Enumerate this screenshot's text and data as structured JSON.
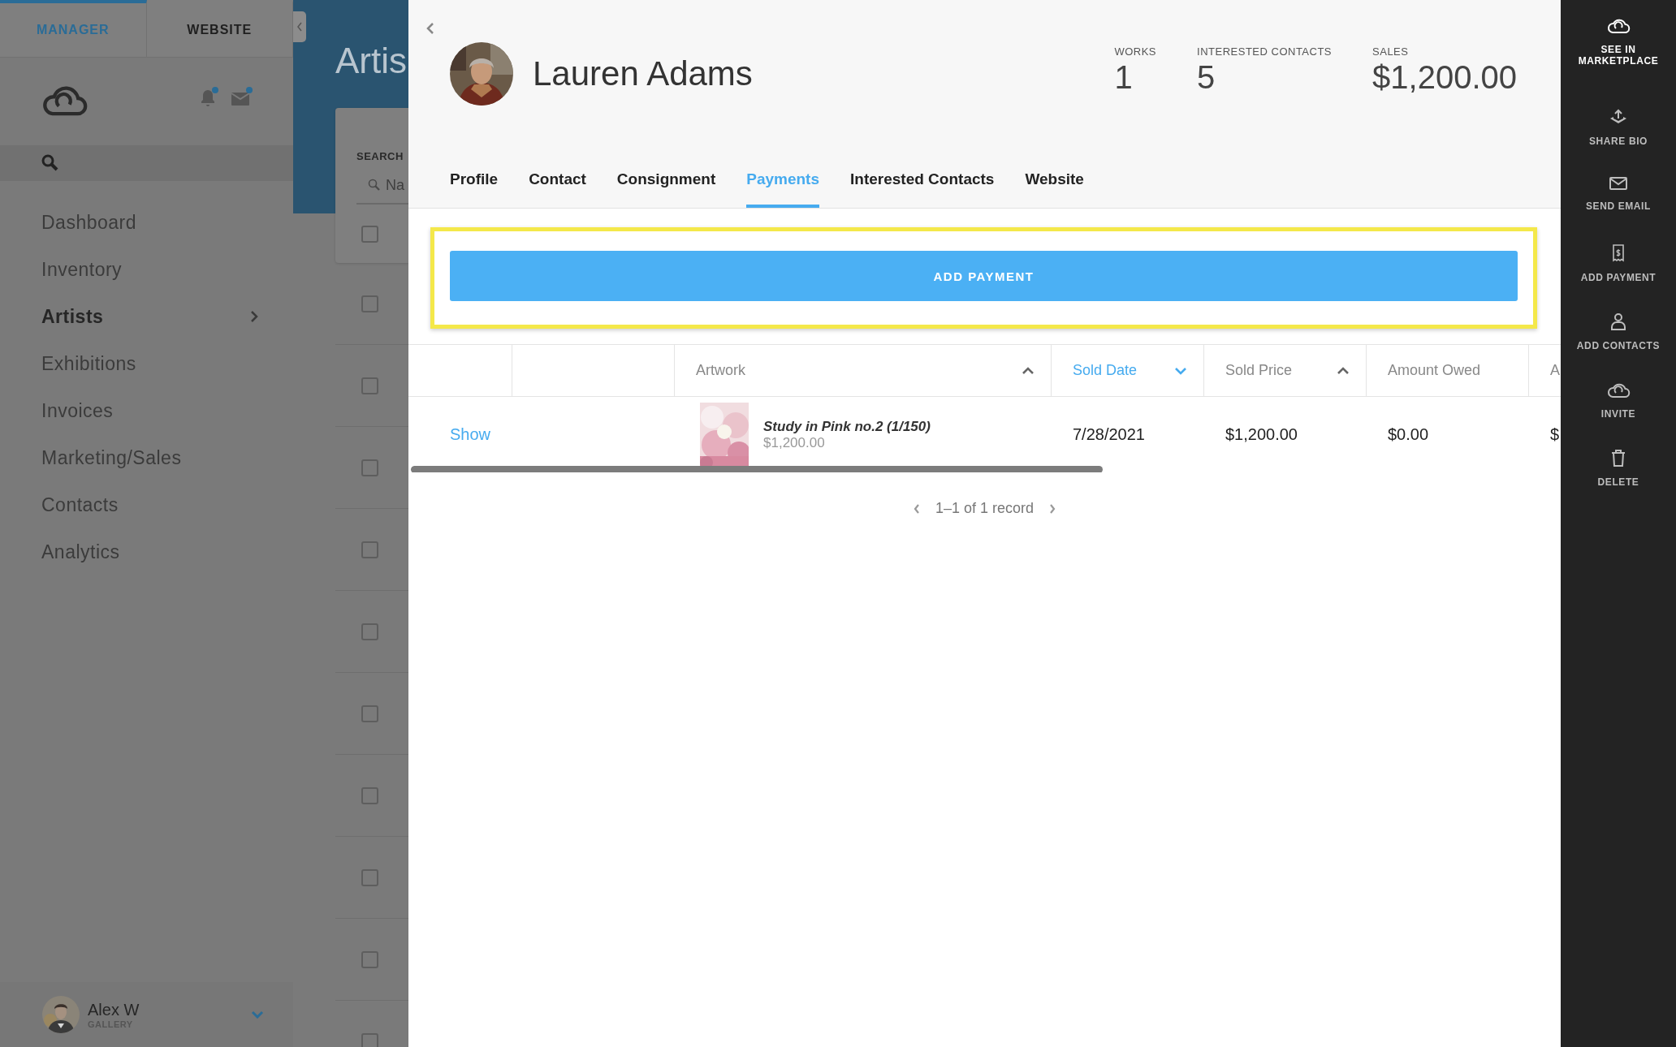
{
  "sidebar": {
    "tabs": [
      {
        "label": "MANAGER",
        "selected": true
      },
      {
        "label": "WEBSITE",
        "selected": false
      }
    ],
    "bell_unread": true,
    "mail_unread": true,
    "nav": [
      {
        "label": "Dashboard",
        "selected": false,
        "has_submenu": false
      },
      {
        "label": "Inventory",
        "selected": false,
        "has_submenu": false
      },
      {
        "label": "Artists",
        "selected": true,
        "has_submenu": true
      },
      {
        "label": "Exhibitions",
        "selected": false,
        "has_submenu": false
      },
      {
        "label": "Invoices",
        "selected": false,
        "has_submenu": false
      },
      {
        "label": "Marketing/Sales",
        "selected": false,
        "has_submenu": false
      },
      {
        "label": "Contacts",
        "selected": false,
        "has_submenu": false
      },
      {
        "label": "Analytics",
        "selected": false,
        "has_submenu": false
      }
    ],
    "user": {
      "name": "Alex W",
      "role": "GALLERY"
    }
  },
  "background_page": {
    "title": "Artis",
    "search_label": "SEARCH",
    "search_placeholder": "Na",
    "rows": [
      {
        "checked": false
      },
      {
        "checked": false
      },
      {
        "checked": false
      },
      {
        "checked": false
      },
      {
        "checked": false
      },
      {
        "checked": false
      },
      {
        "checked": false
      },
      {
        "checked": false
      },
      {
        "checked": false
      },
      {
        "checked": false
      },
      {
        "checked": false
      }
    ]
  },
  "drawer": {
    "artist_name": "Lauren Adams",
    "stats": [
      {
        "label": "WORKS",
        "value": "1"
      },
      {
        "label": "INTERESTED CONTACTS",
        "value": "5"
      },
      {
        "label": "SALES",
        "value": "$1,200.00"
      }
    ],
    "tabs": [
      {
        "label": "Profile",
        "selected": false
      },
      {
        "label": "Contact",
        "selected": false
      },
      {
        "label": "Consignment",
        "selected": false
      },
      {
        "label": "Payments",
        "selected": true
      },
      {
        "label": "Interested Contacts",
        "selected": false
      },
      {
        "label": "Website",
        "selected": false
      }
    ],
    "add_payment": {
      "label": "ADD PAYMENT",
      "highlighted": true
    },
    "table": {
      "columns": [
        {
          "label": "Artwork",
          "sorted": true,
          "descending": false,
          "selected": false
        },
        {
          "label": "Sold Date",
          "sorted": true,
          "descending": true,
          "selected": true
        },
        {
          "label": "Sold Price",
          "sorted": true,
          "descending": false,
          "selected": false
        },
        {
          "label": "Amount Owed",
          "selected": false
        },
        {
          "label": "A",
          "selected": false
        }
      ],
      "rows": [
        {
          "link": "Show",
          "artwork_price": "$1,200.00",
          "cells": [
            "Study in Pink no.2 (1/150)",
            "7/28/2021",
            "$1,200.00",
            "$0.00",
            "$"
          ]
        }
      ]
    },
    "pagination": "1–1 of 1 record"
  },
  "actions": [
    {
      "label": "SEE IN MARKETPLACE",
      "kind": "cloud",
      "highlighted": true
    },
    {
      "label": "SHARE BIO",
      "kind": "share",
      "highlighted": false
    },
    {
      "label": "SEND EMAIL",
      "kind": "mail",
      "highlighted": false
    },
    {
      "label": "ADD PAYMENT",
      "kind": "receipt",
      "highlighted": false
    },
    {
      "label": "ADD CONTACTS",
      "kind": "person",
      "highlighted": false
    },
    {
      "label": "INVITE",
      "kind": "cloud",
      "highlighted": false
    },
    {
      "label": "DELETE",
      "kind": "trash",
      "highlighted": false
    }
  ]
}
